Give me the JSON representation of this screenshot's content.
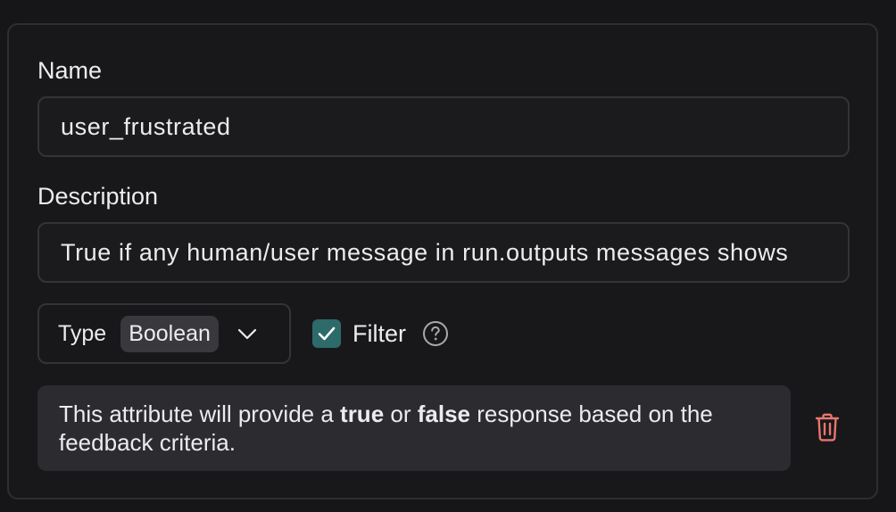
{
  "name_field": {
    "label": "Name",
    "value": "user_frustrated"
  },
  "description_field": {
    "label": "Description",
    "value": "True if any human/user message in run.outputs messages shows"
  },
  "type_select": {
    "label": "Type",
    "value": "Boolean"
  },
  "filter": {
    "label": "Filter",
    "checked": true
  },
  "info": {
    "prefix": "This attribute will provide a ",
    "bold1": "true",
    "middle": " or ",
    "bold2": "false",
    "suffix": " response based on the feedback criteria."
  },
  "colors": {
    "accent_checkbox": "#2d6a6a",
    "delete": "#e8766e"
  },
  "icons": {
    "chevron": "chevron-down-icon",
    "help": "question-circle-icon",
    "delete": "trash-icon",
    "check": "check-icon"
  }
}
